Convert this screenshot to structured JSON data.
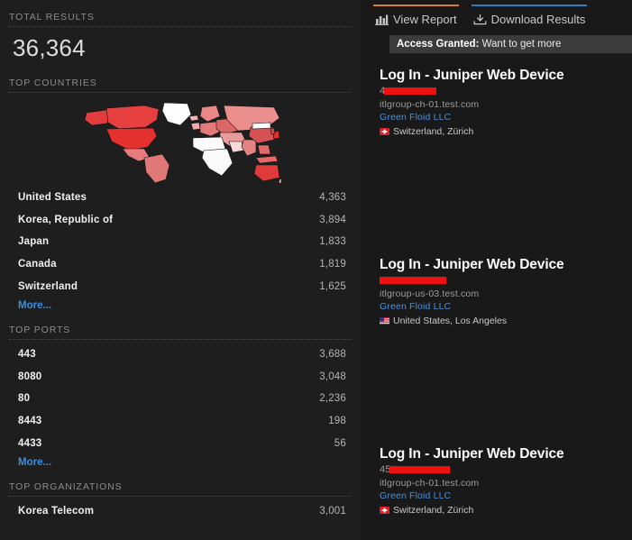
{
  "sidebar": {
    "total": {
      "label": "TOTAL RESULTS",
      "value": "36,364"
    },
    "countries": {
      "label": "TOP COUNTRIES",
      "map_icon": "world-choropleth-map",
      "rows": [
        {
          "name": "United States",
          "count": "4,363"
        },
        {
          "name": "Korea, Republic of",
          "count": "3,894"
        },
        {
          "name": "Japan",
          "count": "1,833"
        },
        {
          "name": "Canada",
          "count": "1,819"
        },
        {
          "name": "Switzerland",
          "count": "1,625"
        }
      ],
      "more": "More..."
    },
    "ports": {
      "label": "TOP PORTS",
      "rows": [
        {
          "name": "443",
          "count": "3,688"
        },
        {
          "name": "8080",
          "count": "3,048"
        },
        {
          "name": "80",
          "count": "2,236"
        },
        {
          "name": "8443",
          "count": "198"
        },
        {
          "name": "4433",
          "count": "56"
        }
      ],
      "more": "More..."
    },
    "organizations": {
      "label": "TOP ORGANIZATIONS",
      "rows": [
        {
          "name": "Korea Telecom",
          "count": "3,001"
        }
      ]
    }
  },
  "results": {
    "tabs": [
      {
        "label": "View Report",
        "icon": "bar-chart-icon",
        "accent": "#d98023"
      },
      {
        "label": "Download Results",
        "icon": "download-icon",
        "accent": "#2d7fc1"
      }
    ],
    "banner": {
      "strong": "Access Granted:",
      "text": " Want to get more"
    },
    "items": [
      {
        "title": "Log In - Juniper Web Device",
        "ip_prefix": "4",
        "ip_redacted": true,
        "hostname": "itlgroup-ch-01.test.com",
        "organization": "Green Floid LLC",
        "location": "Switzerland, Zürich",
        "flag": "switzerland-flag"
      },
      {
        "title": "Log In - Juniper Web Device",
        "ip_prefix": "",
        "ip_redacted": true,
        "hostname": "itlgroup-us-03.test.com",
        "organization": "Green Floid LLC",
        "location": "United States, Los Angeles",
        "flag": "united-states-flag"
      },
      {
        "title": "Log In - Juniper Web Device",
        "ip_prefix": "45",
        "ip_redacted": true,
        "hostname": "itlgroup-ch-01.test.com",
        "organization": "Green Floid LLC",
        "location": "Switzerland, Zürich",
        "flag": "switzerland-flag"
      }
    ]
  }
}
